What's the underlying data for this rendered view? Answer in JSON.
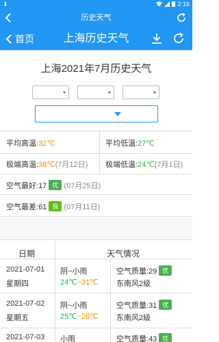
{
  "status": {
    "time": "2:16"
  },
  "appbar": {
    "title": "历史天气"
  },
  "hero": {
    "back_label": "首页",
    "title": "上海历史天气"
  },
  "heading": "上海2021年7月历史天气",
  "selects": {
    "year": "",
    "month": "",
    "day": "",
    "city": ""
  },
  "stats": {
    "avg_high_label": "平均高温:",
    "avg_high": "32℃",
    "avg_low_label": "平均低温:",
    "avg_low": "27℃",
    "max_high_label": "极端高温:",
    "max_high": "38℃",
    "max_high_date": "(7月12日)",
    "min_low_label": "极端低温:",
    "min_low": "24℃",
    "min_low_date": "(7月1日)",
    "best_air_label": "空气最好:",
    "best_air_value": "17",
    "best_air_badge": "优",
    "best_air_date": "(07月25日)",
    "worst_air_label": "空气最差:",
    "worst_air_value": "61",
    "worst_air_badge": "良",
    "worst_air_date": "(07月11日)"
  },
  "table": {
    "headers": {
      "date": "日期",
      "weather": "天气情况"
    },
    "rows": [
      {
        "date": "2021-07-01",
        "weekday": "星期四",
        "weather": "阴~小雨",
        "low": "24℃",
        "sep": "~",
        "high": "31℃",
        "aqi_label": "空气质量:",
        "aqi": "29",
        "aqi_badge": "优",
        "wind": "东南风2级"
      },
      {
        "date": "2021-07-02",
        "weekday": "星期五",
        "weather": "阴~小雨",
        "low": "25℃",
        "sep": "~",
        "high": "28℃",
        "aqi_label": "空气质量:",
        "aqi": "31",
        "aqi_badge": "优",
        "wind": "东南风2级"
      },
      {
        "date": "2021-07-03",
        "weekday": "",
        "weather": "小雨",
        "low": "",
        "sep": "",
        "high": "",
        "aqi_label": "空气质量:",
        "aqi": "43",
        "aqi_badge": "优",
        "wind": ""
      }
    ]
  },
  "colors": {
    "primary": "#2196f3",
    "hot": "#ff8a00",
    "cool": "#22b14c",
    "badge_excellent": "#4caf50",
    "badge_good": "#66bb1a"
  }
}
